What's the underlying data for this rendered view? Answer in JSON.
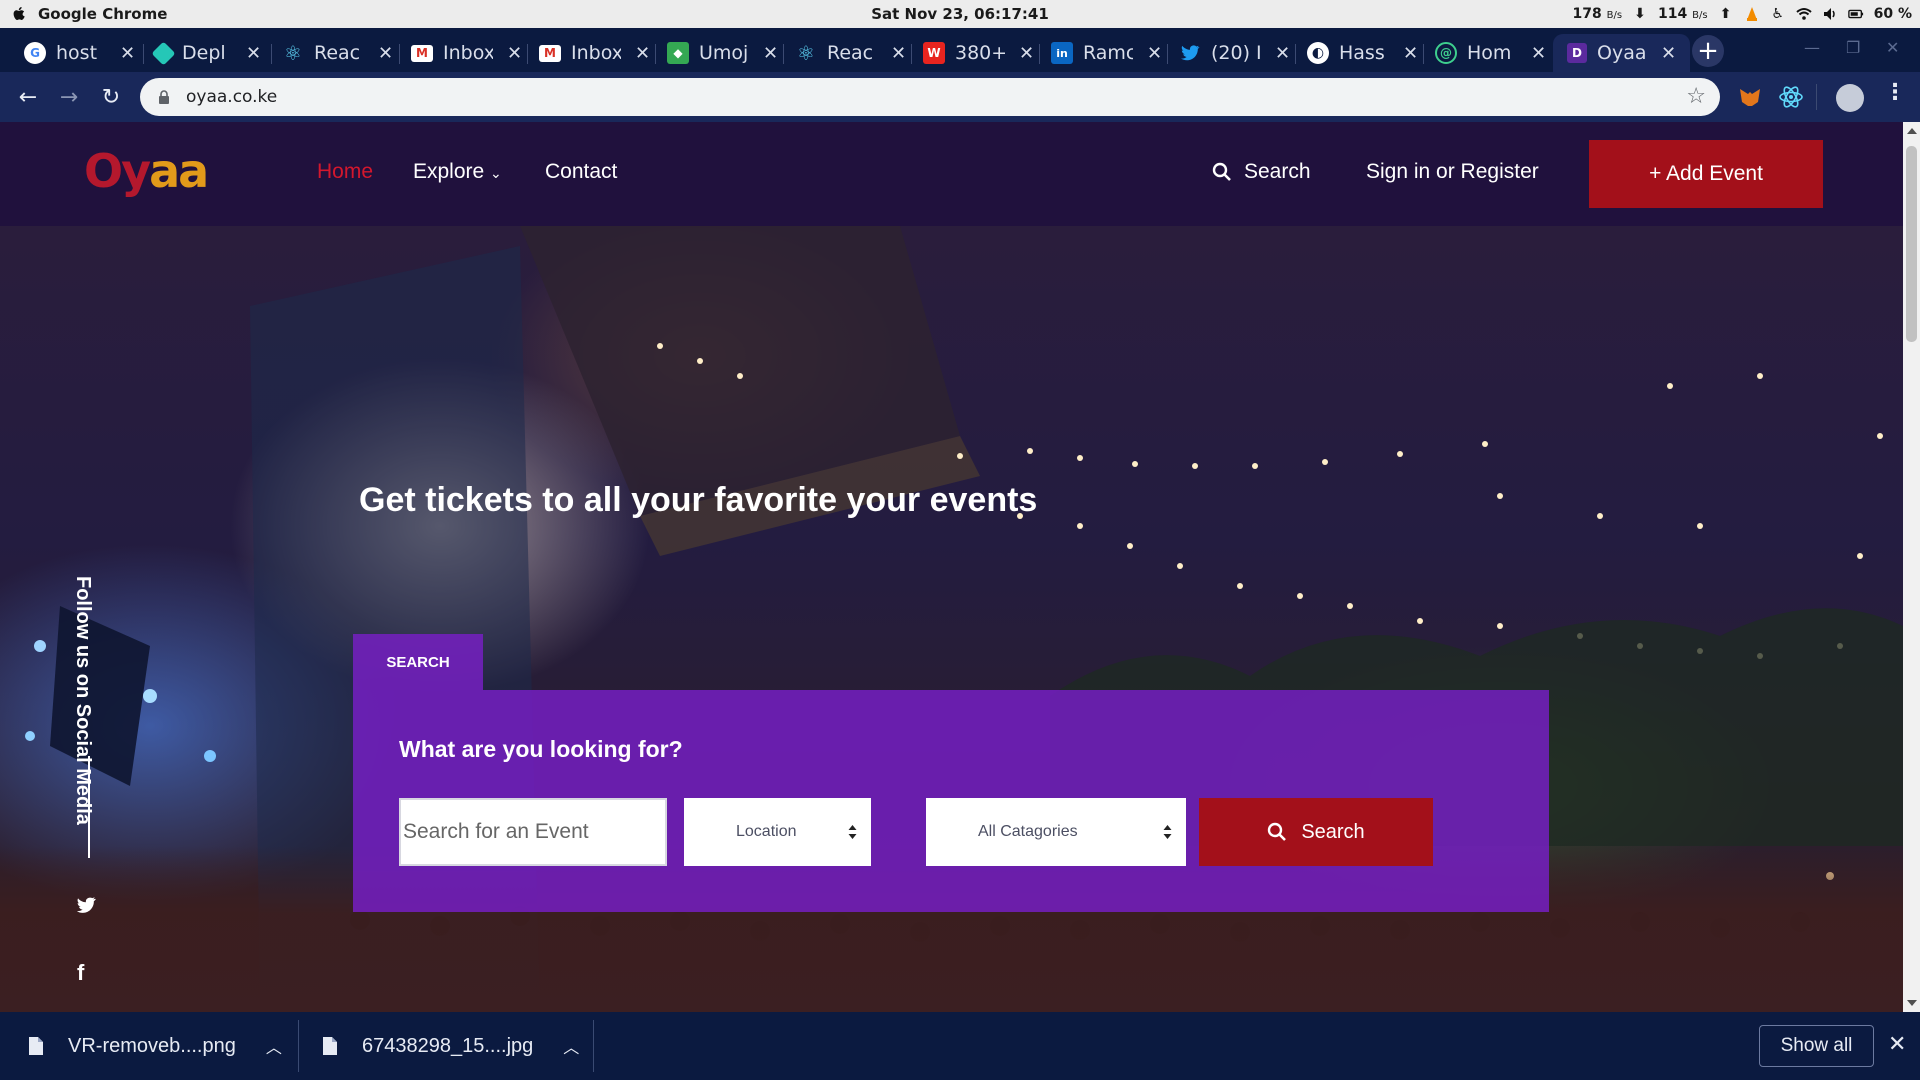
{
  "os": {
    "app_name": "Google Chrome",
    "clock": "Sat Nov 23, 06:17:41",
    "net_up": "178",
    "net_down": "114",
    "net_unit": "B/s",
    "battery": "60 %"
  },
  "tabs": [
    {
      "label": "host",
      "icon": "google-icon",
      "color": "#ffffff"
    },
    {
      "label": "Depl",
      "icon": "netlify-icon",
      "color": "#25c7b7"
    },
    {
      "label": "Reac",
      "icon": "react-icon",
      "color": "#61dafb"
    },
    {
      "label": "Inbox",
      "icon": "gmail-icon",
      "color": "#d93025"
    },
    {
      "label": "Inbox",
      "icon": "gmail-icon",
      "color": "#d93025"
    },
    {
      "label": "Umoj",
      "icon": "maps-icon",
      "color": "#34a853"
    },
    {
      "label": "Reac",
      "icon": "react-icon",
      "color": "#61dafb"
    },
    {
      "label": "380+",
      "icon": "w-icon",
      "color": "#e8241f"
    },
    {
      "label": "Ramc",
      "icon": "linkedin-icon",
      "color": "#0a66c2"
    },
    {
      "label": "(20) I",
      "icon": "twitter-icon",
      "color": "#1d9bf0"
    },
    {
      "label": "Hass",
      "icon": "globe-icon",
      "color": "#ffffff"
    },
    {
      "label": "Hom",
      "icon": "home-site-icon",
      "color": "#3ecf8e"
    },
    {
      "label": "Oyaa",
      "icon": "d-icon",
      "color": "#5b2a9e"
    }
  ],
  "toolbar": {
    "url": "oyaa.co.ke"
  },
  "site": {
    "nav": {
      "home": "Home",
      "explore": "Explore",
      "contact": "Contact",
      "search": "Search",
      "signin": "Sign in or Register",
      "add_event": "+ Add Event"
    },
    "hero_title": "Get tickets to all your favorite your events",
    "social_text": "Follow us on Social Media",
    "search": {
      "tab_label": "SEARCH",
      "question": "What are you looking for?",
      "event_placeholder": "Search for an Event",
      "location": "Location",
      "categories": "All Catagories",
      "button": "Search"
    }
  },
  "downloads": {
    "items": [
      "VR-removeb....png",
      "67438298_15....jpg"
    ],
    "show_all": "Show all"
  },
  "colors": {
    "nav_bg": "#20113d",
    "accent_red": "#a3101a",
    "panel_purple": "#781ec8",
    "chrome_dark": "#0b1a40"
  }
}
